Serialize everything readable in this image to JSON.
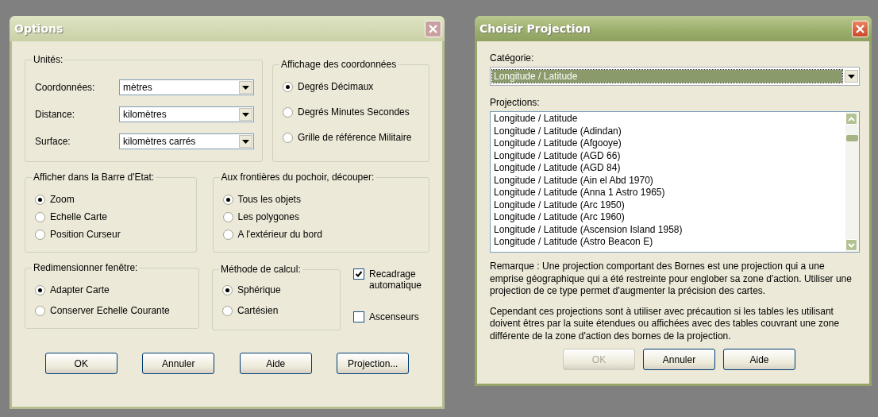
{
  "options_dialog": {
    "title": "Options",
    "active": false,
    "units": {
      "title": "Unités:",
      "rows": [
        {
          "label": "Coordonnées:",
          "value": "mètres"
        },
        {
          "label": "Distance:",
          "value": "kilomètres"
        },
        {
          "label": "Surface:",
          "value": "kilomètres carrés"
        }
      ]
    },
    "coordinate_display": {
      "title": "Affichage des coordonnées",
      "options": [
        {
          "label": "Degrés Décimaux",
          "selected": true
        },
        {
          "label": "Degrés Minutes Secondes",
          "selected": false
        },
        {
          "label": "Grille de référence Militaire",
          "selected": false
        }
      ]
    },
    "status_bar_display": {
      "title": "Afficher dans la Barre d'Etat:",
      "options": [
        {
          "label": "Zoom",
          "selected": true
        },
        {
          "label": "Echelle Carte",
          "selected": false
        },
        {
          "label": "Position Curseur",
          "selected": false
        }
      ]
    },
    "clip_region": {
      "title": "Aux frontières du pochoir, découper:",
      "options": [
        {
          "label": "Tous les objets",
          "selected": true
        },
        {
          "label": "Les polygones",
          "selected": false
        },
        {
          "label": "A l'extérieur du bord",
          "selected": false
        }
      ]
    },
    "resize_window": {
      "title": "Redimensionner fenêtre:",
      "options": [
        {
          "label": "Adapter Carte",
          "selected": true
        },
        {
          "label": "Conserver Echelle Courante",
          "selected": false
        }
      ]
    },
    "calculation_method": {
      "title": "Méthode de calcul:",
      "options": [
        {
          "label": "Sphérique",
          "selected": true
        },
        {
          "label": "Cartésien",
          "selected": false
        }
      ]
    },
    "checkboxes": [
      {
        "label": "Recadrage automatique",
        "checked": true
      },
      {
        "label": "Ascenseurs",
        "checked": false
      }
    ],
    "buttons": [
      {
        "label": "OK",
        "disabled": false
      },
      {
        "label": "Annuler",
        "disabled": false
      },
      {
        "label": "Aide",
        "disabled": false
      },
      {
        "label": "Projection...",
        "disabled": false
      }
    ]
  },
  "projection_dialog": {
    "title": "Choisir Projection",
    "active": true,
    "category_label": "Catégorie:",
    "category": {
      "value": "Longitude / Latitude",
      "selected": true
    },
    "projections_label": "Projections:",
    "projections": [
      "Longitude / Latitude",
      "Longitude / Latitude (Adindan)",
      "Longitude / Latitude (Afgooye)",
      "Longitude / Latitude (AGD 66)",
      "Longitude / Latitude (AGD 84)",
      "Longitude / Latitude (Ain el Abd 1970)",
      "Longitude / Latitude (Anna 1 Astro 1965)",
      "Longitude / Latitude (Arc 1950)",
      "Longitude / Latitude (Arc 1960)",
      "Longitude / Latitude (Ascension Island 1958)",
      "Longitude / Latitude (Astro Beacon E)"
    ],
    "notes": [
      "Remarque : Une projection comportant des Bornes est une projection qui a une emprise géographique qui a été restreinte pour englober sa zone d'action. Utiliser une projection de ce type permet d'augmenter la précision des cartes.",
      "Cependant ces projections sont à utiliser avec précaution si les tables les utilisant doivent êtres par la suite étendues ou affichées avec des tables couvrant une zone différente de la zone d'action des bornes de la projection."
    ],
    "buttons": [
      {
        "label": "OK",
        "disabled": true
      },
      {
        "label": "Annuler",
        "disabled": false
      },
      {
        "label": "Aide",
        "disabled": false
      }
    ]
  }
}
